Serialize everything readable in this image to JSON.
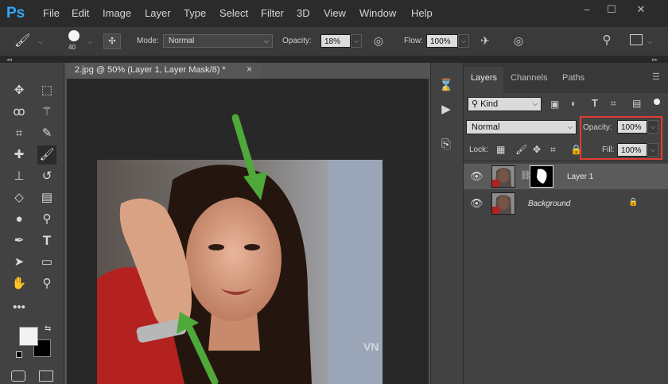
{
  "app": {
    "logo_text": "Ps"
  },
  "menu": [
    "File",
    "Edit",
    "Image",
    "Layer",
    "Type",
    "Select",
    "Filter",
    "3D",
    "View",
    "Window",
    "Help"
  ],
  "window_controls": {
    "minimize": "–",
    "maximize": "☐",
    "close": "✕"
  },
  "options_bar": {
    "brush_size": "40",
    "mode_label": "Mode:",
    "mode_value": "Normal",
    "opacity_label": "Opacity:",
    "opacity_value": "18%",
    "flow_label": "Flow:",
    "flow_value": "100%"
  },
  "document_tab": {
    "title": "2.jpg @ 50% (Layer 1, Layer Mask/8) *",
    "close": "×"
  },
  "layers_panel": {
    "tabs": [
      "Layers",
      "Channels",
      "Paths"
    ],
    "filter_kind": "Kind",
    "blend_mode": "Normal",
    "opacity_label": "Opacity:",
    "opacity_value": "100%",
    "lock_label": "Lock:",
    "fill_label": "Fill:",
    "fill_value": "100%",
    "layers": [
      {
        "name": "Layer 1",
        "selected": true
      },
      {
        "name": "Background",
        "locked": true
      }
    ]
  },
  "watermark": "VN",
  "colors": {
    "accent_arrow": "#4fa83a",
    "highlight_box": "#e33b33",
    "ps_blue": "#31a8ff"
  },
  "icons": [
    "brush-icon",
    "move-icon",
    "marquee-icon",
    "lasso-icon",
    "magic-wand-icon",
    "crop-icon",
    "eyedropper-icon",
    "healing-icon",
    "brush-tool-icon",
    "stamp-icon",
    "history-brush-icon",
    "eraser-icon",
    "gradient-icon",
    "blur-icon",
    "dodge-icon",
    "pen-icon",
    "type-icon",
    "path-select-icon",
    "shape-icon",
    "hand-icon",
    "zoom-icon",
    "more-icon",
    "search-icon",
    "workspace-icon",
    "history-icon",
    "play-icon",
    "glyphs-icon",
    "eye-icon",
    "lock-icon",
    "chain-icon"
  ]
}
